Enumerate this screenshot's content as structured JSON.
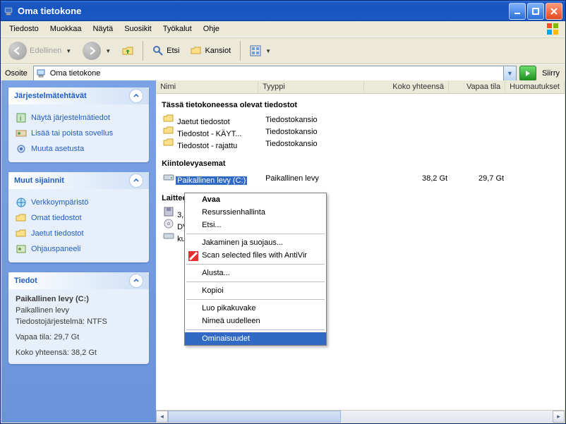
{
  "window": {
    "title": "Oma tietokone"
  },
  "menu": {
    "items": [
      "Tiedosto",
      "Muokkaa",
      "Näytä",
      "Suosikit",
      "Työkalut",
      "Ohje"
    ]
  },
  "toolbar": {
    "back": "Edellinen",
    "search": "Etsi",
    "folders": "Kansiot"
  },
  "address": {
    "label": "Osoite",
    "value": "Oma tietokone",
    "go": "Siirry"
  },
  "sidebar": {
    "panels": [
      {
        "title": "Järjestelmätehtävät",
        "tasks": [
          {
            "icon": "info",
            "label": "Näytä järjestelmätiedot"
          },
          {
            "icon": "addremove",
            "label": "Lisää tai poista sovellus"
          },
          {
            "icon": "settings",
            "label": "Muuta asetusta"
          }
        ]
      },
      {
        "title": "Muut sijainnit",
        "tasks": [
          {
            "icon": "network",
            "label": "Verkkoympäristö"
          },
          {
            "icon": "mydocs",
            "label": "Omat tiedostot"
          },
          {
            "icon": "shared",
            "label": "Jaetut tiedostot"
          },
          {
            "icon": "controlpanel",
            "label": "Ohjauspaneeli"
          }
        ]
      }
    ],
    "details": {
      "title": "Tiedot",
      "name": "Paikallinen levy (C:)",
      "type": "Paikallinen levy",
      "fs": "Tiedostojärjestelmä: NTFS",
      "free": "Vapaa tila: 29,7 Gt",
      "total": "Koko yhteensä: 38,2 Gt"
    }
  },
  "columns": {
    "name": "Nimi",
    "type": "Tyyppi",
    "total": "Koko yhteensä",
    "free": "Vapaa tila",
    "comments": "Huomautukset"
  },
  "groups": {
    "files_here": "Tässä tietokoneessa olevat tiedostot",
    "hdd": "Kiintolevyasemat",
    "removable": "Laitteet, joissa on siirrettävä tallennusväline"
  },
  "items": {
    "folders": [
      {
        "name": "Jaetut tiedostot",
        "type": "Tiedostokansio"
      },
      {
        "name": "Tiedostot - KÄYT...",
        "type": "Tiedostokansio"
      },
      {
        "name": "Tiedostot - rajattu",
        "type": "Tiedostokansio"
      }
    ],
    "drives": [
      {
        "name": "Paikallinen levy (C:)",
        "type": "Paikallinen levy",
        "total": "38,2 Gt",
        "free": "29,7 Gt"
      }
    ],
    "removable": [
      {
        "name": "3,5 tuuman levyke (A:)"
      },
      {
        "name": "DVD-asema (D:)"
      },
      {
        "name": "kuva (E:)"
      }
    ]
  },
  "context_menu": {
    "items": [
      {
        "label": "Avaa",
        "bold": true
      },
      {
        "label": "Resurssienhallinta"
      },
      {
        "label": "Etsi..."
      },
      {
        "sep": true
      },
      {
        "label": "Jakaminen ja suojaus..."
      },
      {
        "label": "Scan selected files with AntiVir",
        "icon": "antivir"
      },
      {
        "sep": true
      },
      {
        "label": "Alusta..."
      },
      {
        "sep": true
      },
      {
        "label": "Kopioi"
      },
      {
        "sep": true
      },
      {
        "label": "Luo pikakuvake"
      },
      {
        "label": "Nimeä uudelleen"
      },
      {
        "sep": true
      },
      {
        "label": "Ominaisuudet",
        "hovered": true
      }
    ]
  }
}
